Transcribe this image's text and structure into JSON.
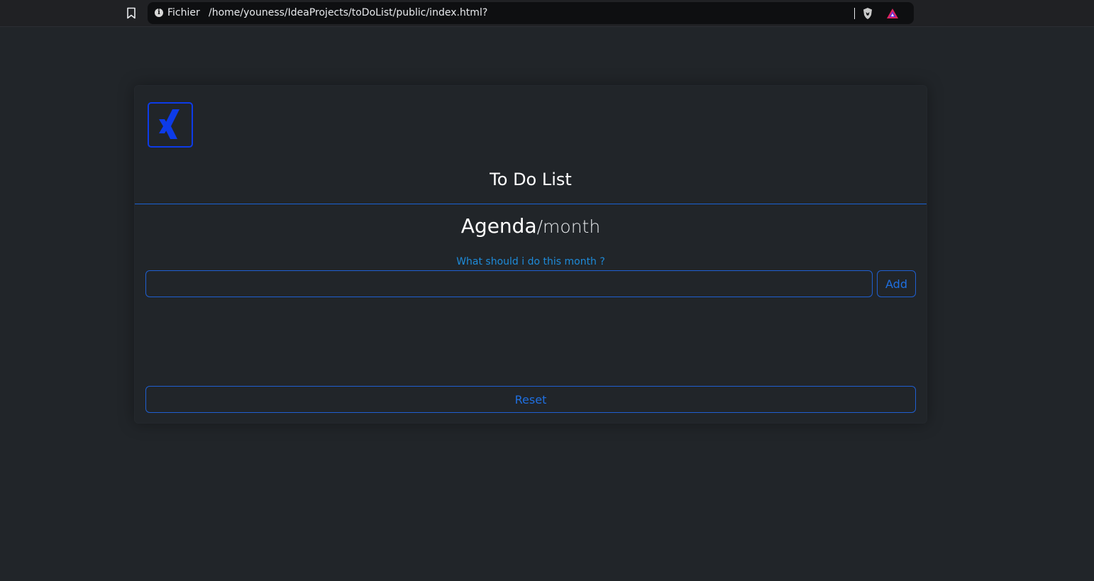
{
  "browser": {
    "scheme_label": "Fichier",
    "url": "/home/youness/IdeaProjects/toDoList/public/index.html?",
    "icons": [
      "bookmark-icon",
      "info-icon",
      "shield-icon",
      "rewards-icon"
    ]
  },
  "app": {
    "title": "To Do List",
    "logo_icon": "xing-logo-icon",
    "accent_color": "#0d3be8",
    "border_color": "#1f5fd1"
  },
  "agenda": {
    "main": "Agenda",
    "sub": "/month",
    "prompt": "What should i do this month ?",
    "input_value": "",
    "add_label": "Add",
    "reset_label": "Reset",
    "items": []
  }
}
